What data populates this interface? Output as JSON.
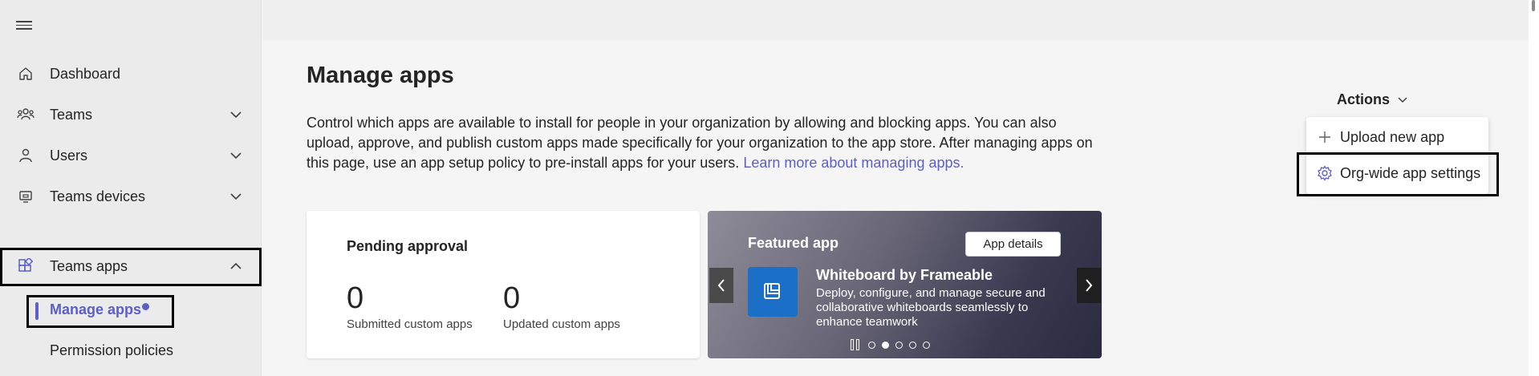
{
  "sidebar": {
    "menu_icon": "hamburger-icon",
    "items": [
      {
        "label": "Dashboard",
        "icon": "home-icon"
      },
      {
        "label": "Teams",
        "icon": "teams-icon"
      },
      {
        "label": "Users",
        "icon": "user-icon"
      },
      {
        "label": "Teams devices",
        "icon": "devices-icon"
      },
      {
        "label": "Teams apps",
        "icon": "apps-icon"
      }
    ],
    "sub_items": [
      {
        "label": "Manage apps"
      },
      {
        "label": "Permission policies"
      }
    ]
  },
  "main": {
    "title": "Manage apps",
    "description": "Control which apps are available to install for people in your organization by allowing and blocking apps. You can also upload, approve, and publish custom apps made specifically for your organization to the app store. After managing apps on this page, use an app setup policy to pre-install apps for your users. ",
    "learn_more": "Learn more about managing apps.",
    "actions": {
      "label": "Actions",
      "menu": [
        {
          "label": "Upload new app",
          "icon": "plus-icon"
        },
        {
          "label": "Org-wide app settings",
          "icon": "gear-icon"
        }
      ]
    },
    "pending": {
      "title": "Pending approval",
      "stats": [
        {
          "value": "0",
          "label": "Submitted custom apps"
        },
        {
          "value": "0",
          "label": "Updated custom apps"
        }
      ]
    },
    "featured": {
      "label": "Featured app",
      "button": "App details",
      "app_name": "Whiteboard by Frameable",
      "app_description": "Deploy, configure, and manage secure and collaborative whiteboards seamlessly to enhance teamwork",
      "carousel_active_index": 1,
      "carousel_count": 5
    }
  },
  "colors": {
    "accent": "#5b5fc7",
    "sidebar_bg": "#ebebeb",
    "main_bg": "#f5f5f5"
  }
}
